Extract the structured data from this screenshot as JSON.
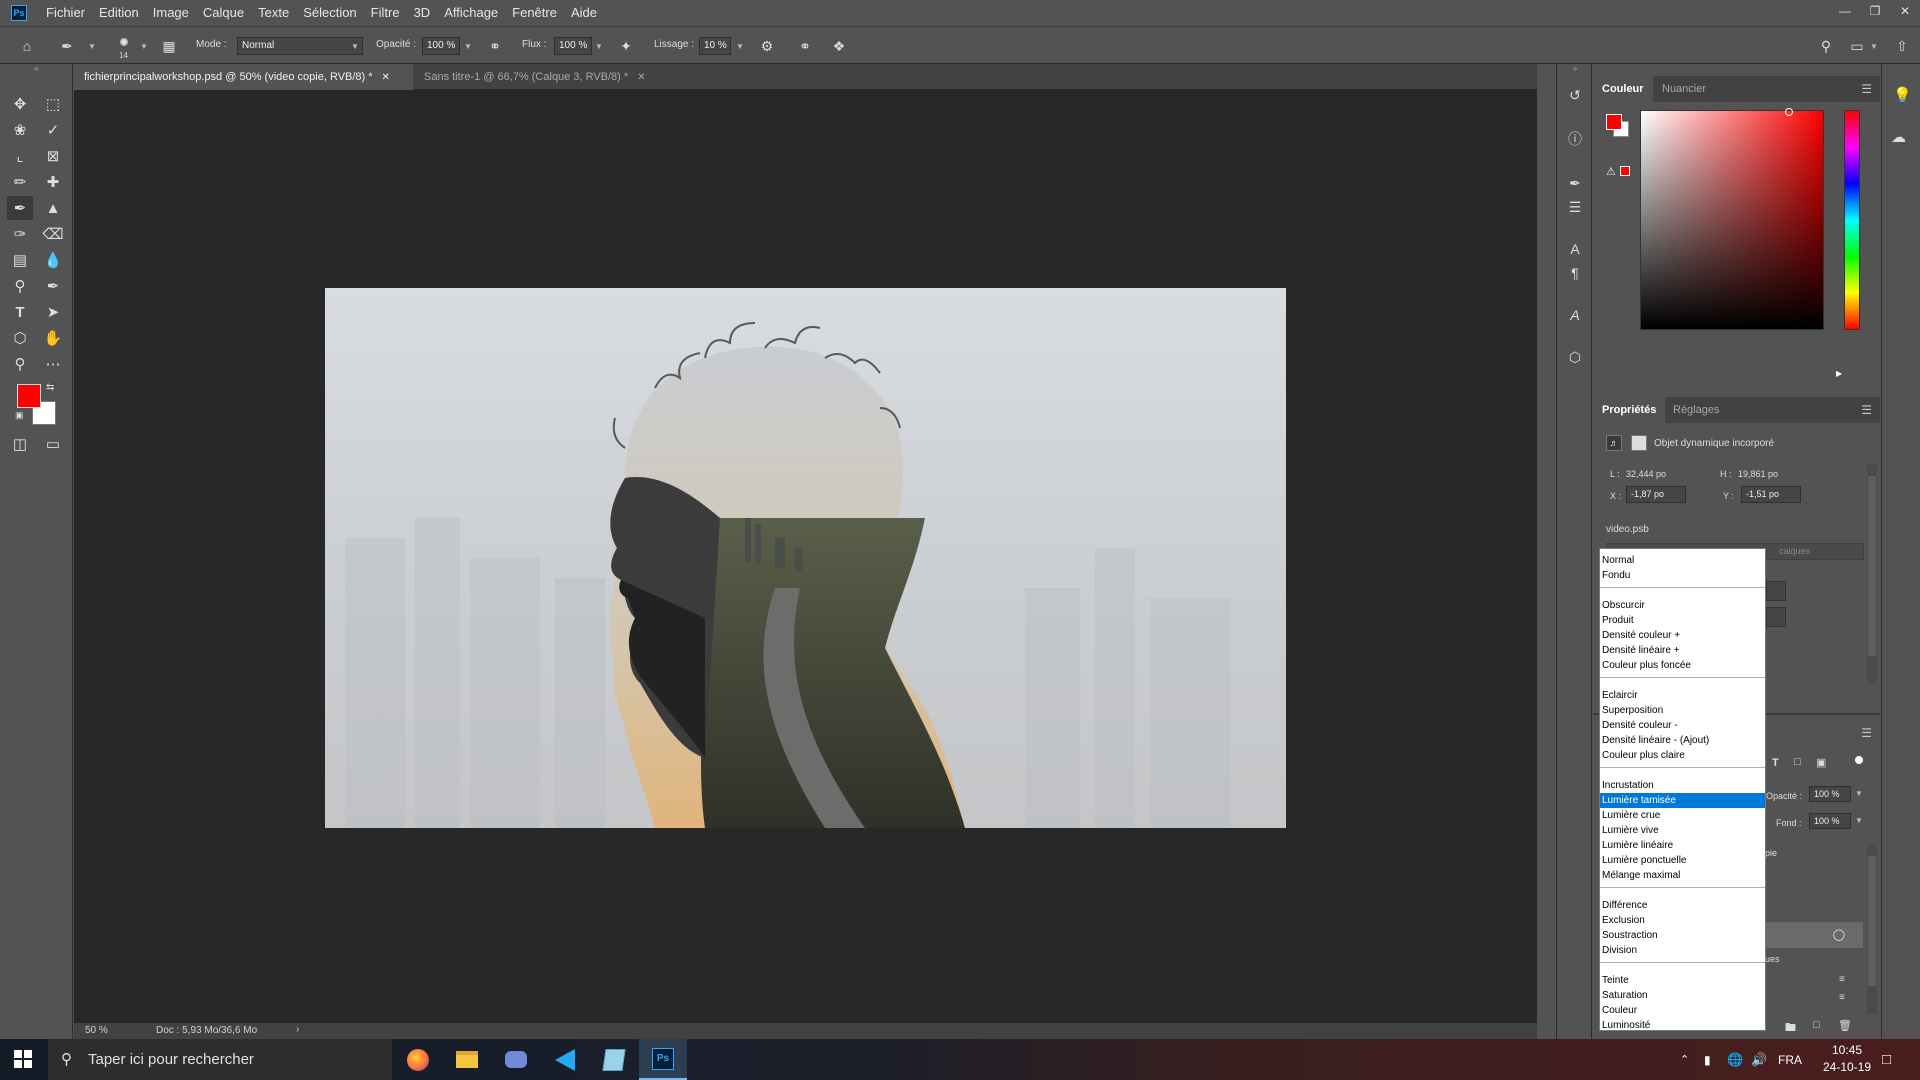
{
  "menubar": {
    "logo": "Ps",
    "items": [
      "Fichier",
      "Edition",
      "Image",
      "Calque",
      "Texte",
      "Sélection",
      "Filtre",
      "3D",
      "Affichage",
      "Fenêtre",
      "Aide"
    ]
  },
  "options": {
    "brush_size": "14",
    "mode_label": "Mode :",
    "mode_value": "Normal",
    "opacity_label": "Opacité :",
    "opacity_value": "100 %",
    "flow_label": "Flux :",
    "flow_value": "100 %",
    "smoothing_label": "Lissage :",
    "smoothing_value": "10 %"
  },
  "tabs": [
    {
      "label": "fichierprincipalworkshop.psd @ 50% (video copie, RVB/8) *",
      "active": true
    },
    {
      "label": "Sans titre-1 @ 66,7% (Calque 3, RVB/8) *",
      "active": false
    }
  ],
  "status": {
    "zoom": "50 %",
    "doc_size": "Doc : 5,93 Mo/36,6 Mo"
  },
  "colors": {
    "foreground": "#ff0000",
    "background": "#ffffff",
    "accent": "#0078d7"
  },
  "color_panel": {
    "tabs": [
      "Couleur",
      "Nuancier"
    ]
  },
  "properties_panel": {
    "tabs": [
      "Propriétés",
      "Réglages"
    ],
    "object_type": "Objet dynamique incorporé",
    "w_label": "L :",
    "w_value": "32,444 po",
    "h_label": "H :",
    "h_value": "19,861 po",
    "x_label": "X :",
    "x_value": "-1,87 po",
    "y_label": "Y :",
    "y_value": "-1,51 po",
    "filename": "video.psb",
    "partial_text": "calques"
  },
  "layers_panel": {
    "opacity_label": "Opacité :",
    "opacity_value": "100 %",
    "fill_label": "Fond :",
    "fill_value": "100 %",
    "partial_layer_text": "pie",
    "partial_text2": "ues"
  },
  "blend_modes": {
    "selected": "Lumière tamisée",
    "groups": [
      [
        "Normal",
        "Fondu"
      ],
      [
        "Obscurcir",
        "Produit",
        "Densité couleur +",
        "Densité linéaire +",
        "Couleur plus foncée"
      ],
      [
        "Eclaircir",
        "Superposition",
        "Densité couleur -",
        "Densité linéaire - (Ajout)",
        "Couleur plus claire"
      ],
      [
        "Incrustation",
        "Lumière tamisée",
        "Lumière crue",
        "Lumière vive",
        "Lumière linéaire",
        "Lumière ponctuelle",
        "Mélange maximal"
      ],
      [
        "Différence",
        "Exclusion",
        "Soustraction",
        "Division"
      ],
      [
        "Teinte",
        "Saturation",
        "Couleur",
        "Luminosité"
      ]
    ]
  },
  "taskbar": {
    "search_placeholder": "Taper ici pour rechercher",
    "language": "FRA",
    "time": "10:45",
    "date": "24-10-19"
  }
}
